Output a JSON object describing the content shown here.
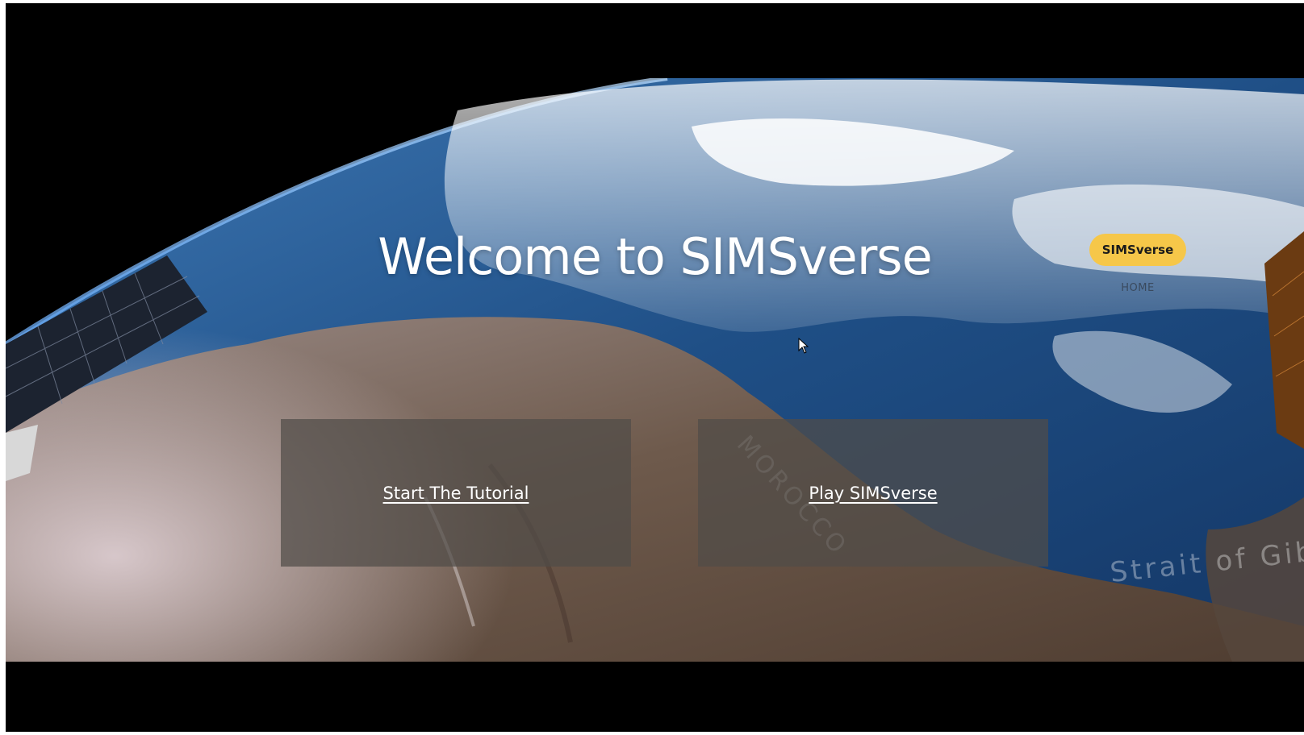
{
  "hero": {
    "title": "Welcome to SIMSverse",
    "map_labels": [
      "MOROCCO",
      "Strait of Gib"
    ]
  },
  "nav": {
    "brand_label": "SIMSverse",
    "home_label": "HOME"
  },
  "cards": [
    {
      "label": "Start The Tutorial"
    },
    {
      "label": "Play SIMSverse"
    }
  ],
  "colors": {
    "brand_pill": "#f6c749",
    "card_overlay": "#504c48",
    "space": "#000000",
    "ocean": "#1e4f86"
  },
  "icons": {
    "cursor": "mouse-pointer-icon"
  }
}
